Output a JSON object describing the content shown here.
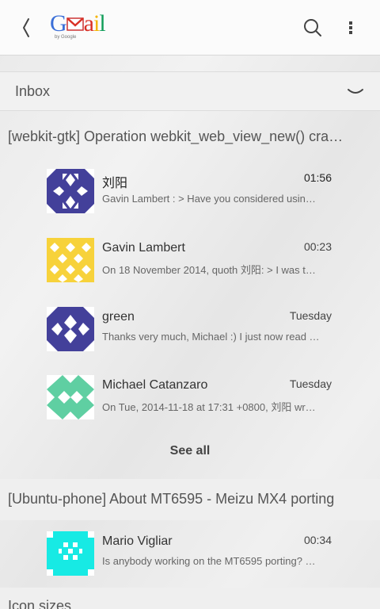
{
  "header": {
    "logo": {
      "text": "Gmail",
      "sub": "by Google"
    },
    "icons": {
      "back": "back-chevron-icon",
      "search": "search-icon",
      "menu": "overflow-menu-icon"
    }
  },
  "folder": {
    "label": "Inbox"
  },
  "threads": [
    {
      "title": "[webkit-gtk] Operation webkit_web_view_new() cra…",
      "messages": [
        {
          "sender": "刘阳",
          "time": "01:56",
          "snippet": "Gavin Lambert : > Have you considered usin…",
          "unread": true
        },
        {
          "sender": "Gavin Lambert",
          "time": "00:23",
          "snippet": "On 18 November 2014, quoth 刘阳: > I was t…",
          "unread": false
        },
        {
          "sender": "green",
          "time": "Tuesday",
          "snippet": "Thanks very much, Michael :) I just now read …",
          "unread": false
        },
        {
          "sender": "Michael Catanzaro",
          "time": "Tuesday",
          "snippet": "On Tue, 2014-11-18 at 17:31 +0800, 刘阳 wr…",
          "unread": false
        }
      ],
      "see_all": "See all"
    },
    {
      "title": "[Ubuntu-phone] About MT6595 - Meizu MX4 porting",
      "messages": [
        {
          "sender": "Mario Vigliar",
          "time": "00:34",
          "snippet": "Is anybody working on the MT6595 porting? …",
          "unread": false
        }
      ]
    },
    {
      "title": "Icon sizes"
    }
  ],
  "colors": {
    "avatar_purple": "#43409a",
    "avatar_yellow": "#f7d23b",
    "avatar_green": "#5fcfa2",
    "avatar_cyan": "#17eae4",
    "gmail_red": "#d93025",
    "gmail_blue": "#3b6fd8"
  }
}
